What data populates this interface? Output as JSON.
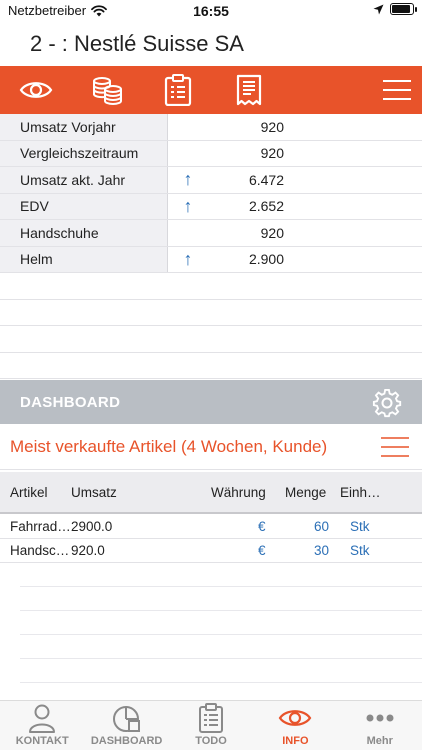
{
  "status": {
    "carrier": "Netzbetreiber",
    "time": "16:55",
    "battery_level": 0.9
  },
  "title": "2 -  : Nestlé Suisse SA",
  "colors": {
    "accent": "#e8532a",
    "link": "#2b6fb6",
    "section_header": "#b9bec4"
  },
  "toolbar": {
    "icons": [
      "eye-icon",
      "coins-icon",
      "clipboard-icon",
      "receipt-icon",
      "hamburger-menu-icon"
    ]
  },
  "info_rows": [
    {
      "label": "Umsatz Vorjahr",
      "arrow": "",
      "value": "920"
    },
    {
      "label": "Vergleichszeitraum",
      "arrow": "",
      "value": "920"
    },
    {
      "label": "Umsatz akt. Jahr",
      "arrow": "↑",
      "value": "6.472"
    },
    {
      "label": "EDV",
      "arrow": "↑",
      "value": "2.652"
    },
    {
      "label": "Handschuhe",
      "arrow": "",
      "value": "920"
    },
    {
      "label": "Helm",
      "arrow": "↑",
      "value": "2.900"
    }
  ],
  "dashboard": {
    "header": "DASHBOARD"
  },
  "section": {
    "title": "Meist verkaufte Artikel (4 Wochen, Kunde)"
  },
  "articles": {
    "columns": [
      "Artikel",
      "Umsatz",
      "Währung",
      "Menge",
      "Einh…"
    ],
    "rows": [
      {
        "artikel": "Fahrrad…",
        "umsatz": "2900.0",
        "waehrung": "€",
        "menge": "60",
        "einheit": "Stk"
      },
      {
        "artikel": "Handsc…",
        "umsatz": "920.0",
        "waehrung": "€",
        "menge": "30",
        "einheit": "Stk"
      }
    ]
  },
  "tabs": [
    {
      "label": "KONTAKT",
      "icon": "person-icon",
      "active": false
    },
    {
      "label": "DASHBOARD",
      "icon": "dashboard-icon",
      "active": false
    },
    {
      "label": "TODO",
      "icon": "clipboard-icon",
      "active": false
    },
    {
      "label": "INFO",
      "icon": "eye-icon",
      "active": true
    },
    {
      "label": "Mehr",
      "icon": "more-dots-icon",
      "active": false
    }
  ]
}
